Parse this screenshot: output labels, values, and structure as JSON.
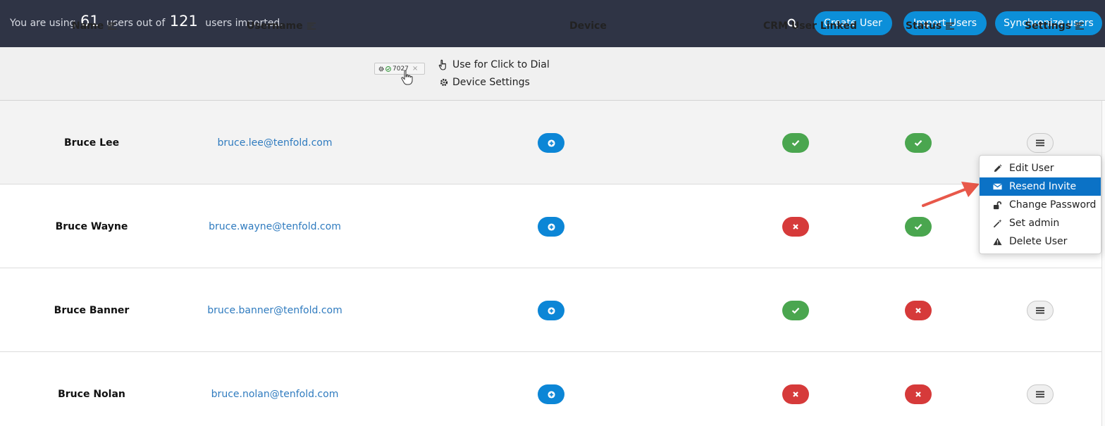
{
  "topbar": {
    "usage_prefix": "You are using",
    "used_count": "61",
    "usage_middle": "users out of",
    "total_count": "121",
    "usage_suffix": "users imported.",
    "buttons": {
      "create": "Create User",
      "import": "Import Users",
      "sync": "Synchronize users"
    }
  },
  "table": {
    "headers": {
      "name": "Name",
      "username": "Username",
      "device": "Device",
      "crm": "CRM User Linked",
      "status": "Status",
      "settings": "Settings"
    },
    "device_popup": {
      "chip_number": "7027",
      "click_to_dial": "Use for Click to Dial",
      "device_settings": "Device Settings"
    },
    "rows": [
      {
        "name": "Bruce Lee",
        "username": "bruce.lee@tenfold.com",
        "crm_linked": true,
        "status_ok": true
      },
      {
        "name": "Bruce Wayne",
        "username": "bruce.wayne@tenfold.com",
        "crm_linked": false,
        "status_ok": true
      },
      {
        "name": "Bruce Banner",
        "username": "bruce.banner@tenfold.com",
        "crm_linked": true,
        "status_ok": false
      },
      {
        "name": "Bruce Nolan",
        "username": "bruce.nolan@tenfold.com",
        "crm_linked": false,
        "status_ok": false
      }
    ]
  },
  "settings_menu": {
    "items": [
      {
        "label": "Edit User",
        "icon": "pencil-icon"
      },
      {
        "label": "Resend Invite",
        "icon": "envelope-icon",
        "active": true
      },
      {
        "label": "Change Password",
        "icon": "unlock-icon"
      },
      {
        "label": "Set admin",
        "icon": "magic-wand-icon"
      },
      {
        "label": "Delete User",
        "icon": "warning-icon"
      }
    ]
  },
  "colors": {
    "topbar_bg": "#2f3445",
    "accent_blue": "#0c8fd9",
    "success_green": "#4aa64f",
    "danger_red": "#d63a3a",
    "link_blue": "#2f7bbf",
    "arrow": "#e8584a"
  }
}
